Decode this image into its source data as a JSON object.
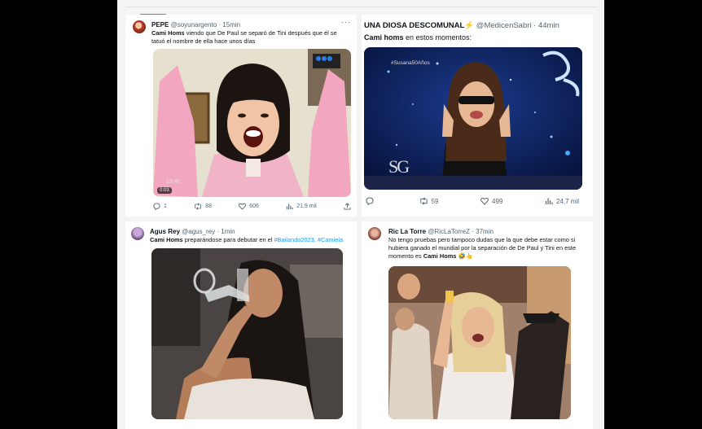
{
  "tweets": [
    {
      "name": "PEPE",
      "handle": "@soyunargento",
      "time": "· 15min",
      "body_bold": "Cami Homs",
      "body_rest": " viendo que De Paul se separó de Tini después que él se tatuó el nombre de ella hace unos días",
      "media_timestamp": "0:03",
      "media_tiny": "13:40",
      "replies": "1",
      "retweets": "88",
      "likes": "606",
      "views": "21,9 mil"
    },
    {
      "name": "UNA DIOSA DESCOMUNAL⚡",
      "handle": "@MedicenSabri",
      "time": "· 44min",
      "body_bold": "Cami homs",
      "body_rest": " en estos momentos:",
      "media_overlay_tag": "#Susana50Años",
      "media_logo": "SG",
      "media_logo_big": "SG",
      "replies": "",
      "retweets": "59",
      "likes": "499",
      "views": "24,7 mil"
    },
    {
      "name": "Agus Rey",
      "handle": "@agus_rey",
      "time": "· 1min",
      "body_bold": "Cami Homs",
      "body_rest": " preparándose para debutar en el ",
      "body_tags": "#Bailando2023, #Camiela"
    },
    {
      "name": "Ric La Torre",
      "handle": "@RicLaTorreZ",
      "time": "· 37min",
      "body_line1": "No tengo pruebas pero tampoco dudas que la que debe estar como si",
      "body_line2": "hubiera ganado el mundial por la separación de De Paul y Tini en este",
      "body_line3_pre": "momento es ",
      "body_line3_bold": "Cami Homs",
      "body_emoji": "🤣👆"
    }
  ],
  "icons": {
    "reply": "reply-icon",
    "retweet": "retweet-icon",
    "like": "heart-icon",
    "views": "views-icon",
    "share": "share-icon",
    "more": "more-icon"
  },
  "colors": {
    "accent": "#1d9bf0",
    "text": "#0f1419",
    "muted": "#536471"
  }
}
